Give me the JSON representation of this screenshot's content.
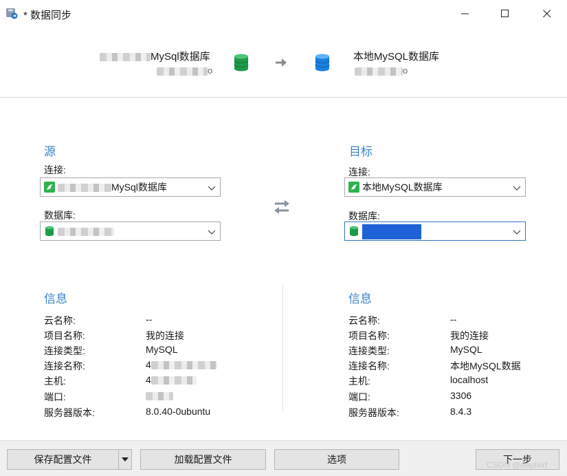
{
  "window": {
    "title": "* 数据同步",
    "icon": "sync-app-icon",
    "controls": [
      "minimize-icon",
      "maximize-icon",
      "close-icon"
    ]
  },
  "header": {
    "source_name": "MySql数据库",
    "source_icon": "database-green-icon",
    "arrow_icon": "arrow-right-icon",
    "target_name": "本地MySQL数据库",
    "target_sub": "o",
    "target_icon": "database-blue-icon"
  },
  "source": {
    "title": "源",
    "connection_label": "连接:",
    "connection_value": "MySql数据库",
    "database_label": "数据库:",
    "database_value": ""
  },
  "swap_icon": "swap-arrows-icon",
  "target": {
    "title": "目标",
    "connection_label": "连接:",
    "connection_value": "本地MySQL数据库",
    "database_label": "数据库:",
    "database_value": ""
  },
  "source_info": {
    "title": "信息",
    "rows": [
      {
        "label": "云名称:",
        "value": "--"
      },
      {
        "label": "项目名称:",
        "value": "我的连接"
      },
      {
        "label": "连接类型:",
        "value": "MySQL"
      },
      {
        "label": "连接名称:",
        "value": "4"
      },
      {
        "label": "主机:",
        "value": "4"
      },
      {
        "label": "端口:",
        "value": ""
      },
      {
        "label": "服务器版本:",
        "value": "8.0.40-0ubuntu"
      }
    ]
  },
  "target_info": {
    "title": "信息",
    "rows": [
      {
        "label": "云名称:",
        "value": "--"
      },
      {
        "label": "项目名称:",
        "value": "我的连接"
      },
      {
        "label": "连接类型:",
        "value": "MySQL"
      },
      {
        "label": "连接名称:",
        "value": "本地MySQL数据"
      },
      {
        "label": "主机:",
        "value": "localhost"
      },
      {
        "label": "端口:",
        "value": "3306"
      },
      {
        "label": "服务器版本:",
        "value": "8.4.3"
      }
    ]
  },
  "buttons": {
    "save_profile": "保存配置文件",
    "load_profile": "加载配置文件",
    "options": "选项",
    "next": "下一步"
  },
  "watermark": "CSDN @dephixf",
  "colors": {
    "section_title": "#3a83c6",
    "selection": "#1e62d8",
    "focus_border": "#2b76c2"
  }
}
